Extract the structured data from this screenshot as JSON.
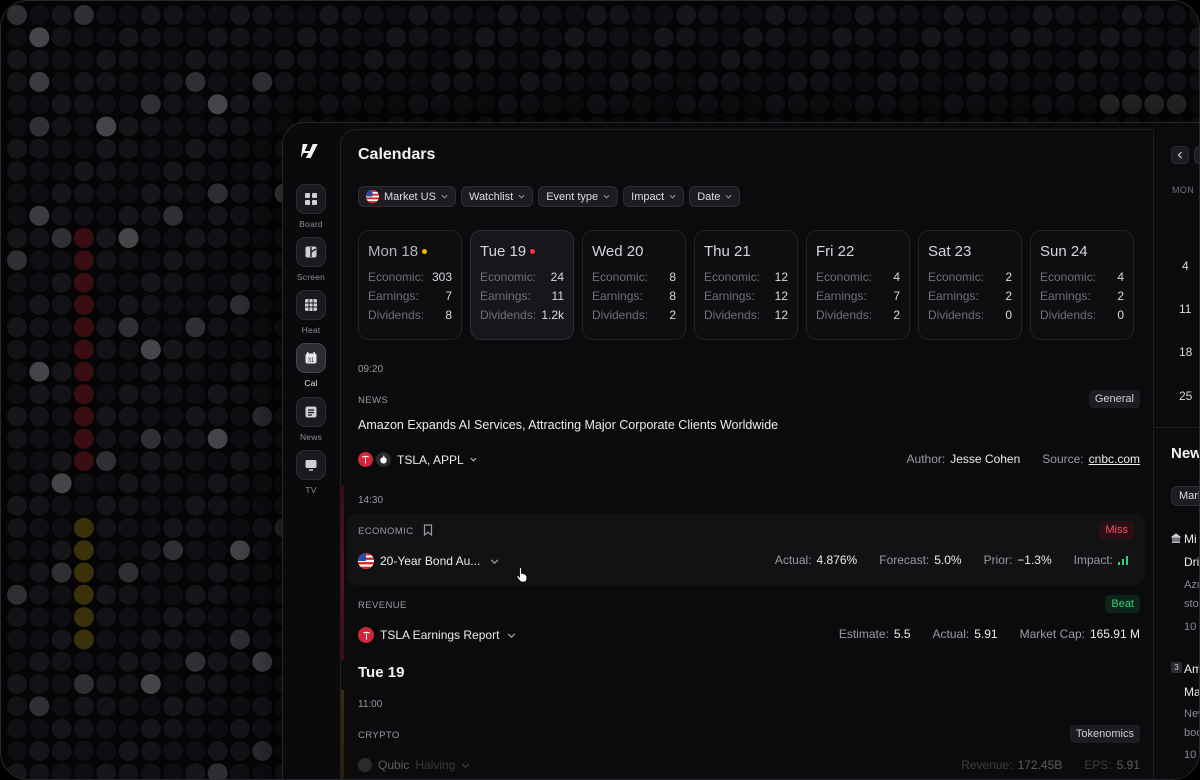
{
  "rail": [
    {
      "label": "Board",
      "icon": "board-icon"
    },
    {
      "label": "Screen",
      "icon": "screen-icon"
    },
    {
      "label": "Heat",
      "icon": "heat-icon"
    },
    {
      "label": "Cal",
      "icon": "calendar-icon",
      "active": true
    },
    {
      "label": "News",
      "icon": "news-icon"
    },
    {
      "label": "TV",
      "icon": "tv-icon"
    }
  ],
  "main": {
    "title": "Calendars",
    "filters": [
      "Market US",
      "Watchlist",
      "Event type",
      "Impact",
      "Date"
    ],
    "days": [
      {
        "name": "Mon 18",
        "dot": "#f5b400",
        "economic": "303",
        "earnings": "7",
        "dividends": "8"
      },
      {
        "name": "Tue 19",
        "dot": "#ff3344",
        "selected": true,
        "economic": "24",
        "earnings": "11",
        "dividends": "1.2k"
      },
      {
        "name": "Wed 20",
        "economic": "8",
        "earnings": "8",
        "dividends": "2"
      },
      {
        "name": "Thu 21",
        "economic": "12",
        "earnings": "12",
        "dividends": "12"
      },
      {
        "name": "Fri 22",
        "economic": "4",
        "earnings": "7",
        "dividends": "2"
      },
      {
        "name": "Sat 23",
        "economic": "2",
        "earnings": "2",
        "dividends": "0"
      },
      {
        "name": "Sun 24",
        "economic": "4",
        "earnings": "2",
        "dividends": "0"
      }
    ],
    "labels": {
      "economic": "Economic:",
      "earnings": "Earnings:",
      "dividends": "Dividends:"
    },
    "news_event": {
      "time": "09:20",
      "category": "NEWS",
      "tag": "General",
      "headline": "Amazon Expands AI Services, Attracting Major Corporate Clients Worldwide",
      "tickers": "TSLA, APPL",
      "author_label": "Author:",
      "author": "Jesse Cohen",
      "source_label": "Source:",
      "source": "cnbc.com"
    },
    "economic_event": {
      "time": "14:30",
      "category": "ECONOMIC",
      "tag": "Miss",
      "name": "20-Year Bond Au...",
      "actual_label": "Actual:",
      "actual": "4.876%",
      "forecast_label": "Forecast:",
      "forecast": "5.0%",
      "prior_label": "Prior:",
      "prior": "−1.3%",
      "impact_label": "Impact:"
    },
    "revenue_event": {
      "category": "REVENUE",
      "tag": "Beat",
      "name": "TSLA Earnings Report",
      "estimate_label": "Estimate:",
      "estimate": "5.5",
      "actual_label": "Actual:",
      "actual": "5.91",
      "mcap_label": "Market Cap:",
      "mcap": "165.91 M"
    },
    "section_title": "Tue 19",
    "crypto_event": {
      "time": "11:00",
      "category": "CRYPTO",
      "tag": "Tokenomics",
      "name": "Qubic",
      "type": "Halving",
      "revenue_label": "Revenue:",
      "revenue": "172.45B",
      "eps_label": "EPS:",
      "eps": "5.91"
    }
  },
  "right_panel": {
    "weekday": "MON",
    "dates": [
      "4",
      "11",
      "18",
      "25"
    ],
    "news_title": "New",
    "chip": "Marl",
    "items": [
      {
        "badge": "",
        "line1": "Mi",
        "line2": "Dri",
        "line3": "Azu",
        "line4": "sto",
        "line5": "10"
      },
      {
        "badge": "3",
        "line1": "Am",
        "line2": "Ma",
        "line3": "New",
        "line4": "boo",
        "line5": "10"
      }
    ]
  },
  "colors": {
    "accent_red": "#ff4d5e",
    "accent_green": "#35d07a",
    "accent_yellow": "#f5b400"
  }
}
